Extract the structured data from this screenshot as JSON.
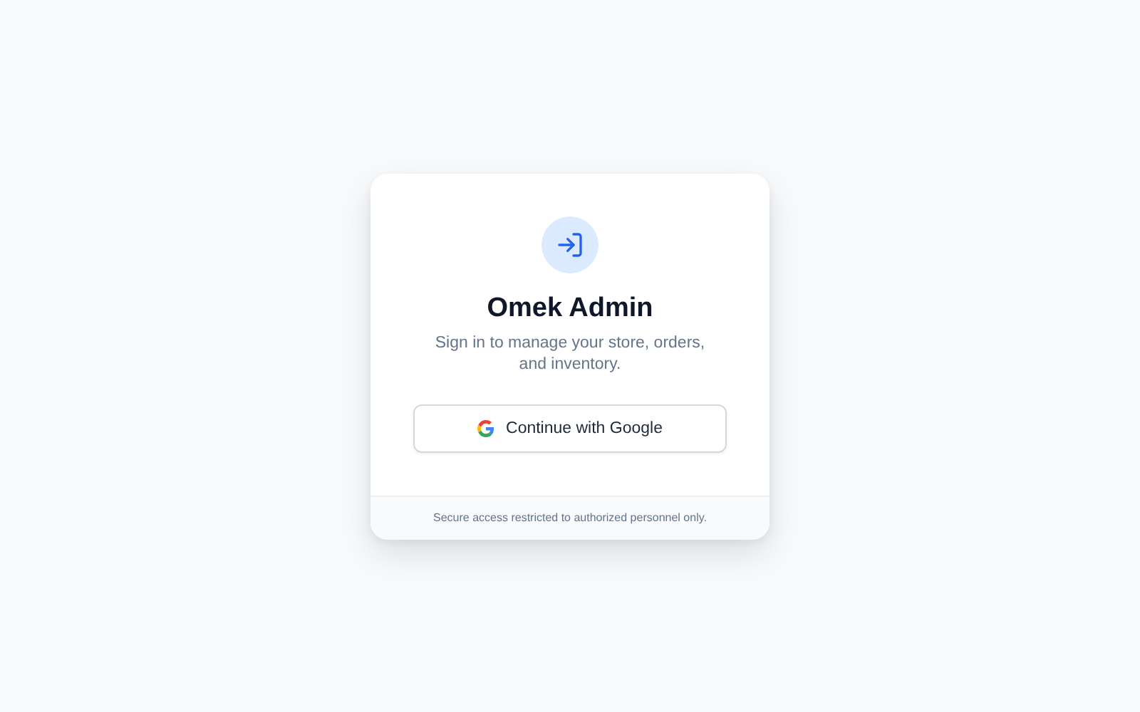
{
  "card": {
    "title": "Omek Admin",
    "subtitle": "Sign in to manage your store, orders, and inventory.",
    "sign_in_button": {
      "label": "Continue with Google"
    },
    "footer": "Secure access restricted to authorized personnel only."
  }
}
